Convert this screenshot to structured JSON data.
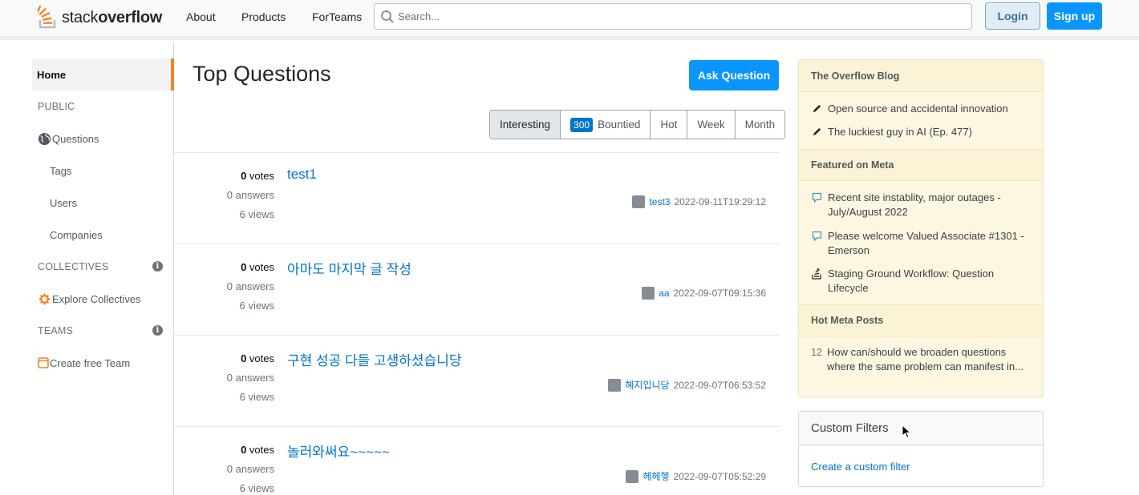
{
  "header": {
    "logo_light": "stack",
    "logo_bold": "overflow",
    "nav": [
      "About",
      "Products",
      "ForTeams"
    ],
    "search_placeholder": "Search...",
    "login_label": "Login",
    "signup_label": "Sign up"
  },
  "sidebar": {
    "home": "Home",
    "public_label": "PUBLIC",
    "questions": "Questions",
    "tags": "Tags",
    "users": "Users",
    "companies": "Companies",
    "collectives_label": "COLLECTIVES",
    "explore_collectives": "Explore Collectives",
    "teams_label": "TEAMS",
    "create_team": "Create free Team",
    "info_glyph": "i"
  },
  "main": {
    "title": "Top Questions",
    "ask_button": "Ask Question",
    "tabs": {
      "interesting": "Interesting",
      "bounty_count": "300",
      "bountied": "Bountied",
      "hot": "Hot",
      "week": "Week",
      "month": "Month"
    },
    "questions": [
      {
        "votes": "0",
        "votes_label": "votes",
        "answers": "0 answers",
        "views": "6 views",
        "title": "test1",
        "user": "test3",
        "time": "2022-09-11T19:29:12"
      },
      {
        "votes": "0",
        "votes_label": "votes",
        "answers": "0 answers",
        "views": "6 views",
        "title": "아마도 마지막 글 작성",
        "user": "aa",
        "time": "2022-09-07T09:15:36"
      },
      {
        "votes": "0",
        "votes_label": "votes",
        "answers": "0 answers",
        "views": "6 views",
        "title": "구현 성공 다들 고생하셨습니당",
        "user": "혜지입니당",
        "time": "2022-09-07T06:53:52"
      },
      {
        "votes": "0",
        "votes_label": "votes",
        "answers": "0 answers",
        "views": "6 views",
        "title": "놀러와써요~~~~~",
        "user": "헤헤헿",
        "time": "2022-09-07T05:52:29"
      }
    ]
  },
  "rail": {
    "blog_title": "The Overflow Blog",
    "blog_items": [
      "Open source and accidental innovation",
      "The luckiest guy in AI (Ep. 477)"
    ],
    "meta_title": "Featured on Meta",
    "meta_items": [
      "Recent site instablity, major outages - July/August 2022",
      "Please welcome Valued Associate #1301 - Emerson",
      "Staging Ground Workflow: Question Lifecycle"
    ],
    "hot_title": "Hot Meta Posts",
    "hot_items": [
      {
        "count": "12",
        "text": "How can/should we broaden questions where the same problem can manifest in..."
      }
    ],
    "filters_title": "Custom Filters",
    "filters_link": "Create a custom filter"
  },
  "colors": {
    "accent": "#0a95ff",
    "link": "#0074cc",
    "brand_orange": "#f48225",
    "rail_bg": "#fdf7e2"
  },
  "icons": [
    "search-icon",
    "globe-icon",
    "collectives-icon",
    "team-icon",
    "pencil-icon",
    "speech-bubble-icon",
    "stack-icon",
    "info-icon",
    "cursor-icon"
  ]
}
